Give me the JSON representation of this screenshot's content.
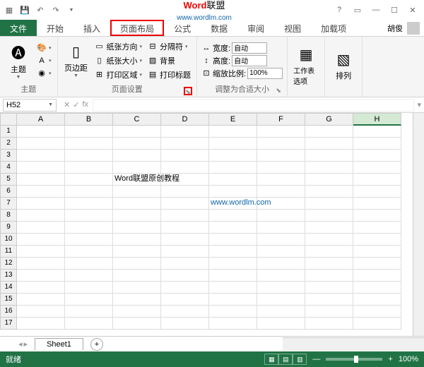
{
  "title": {
    "part1": "Word",
    "part2": "联盟",
    "url": "www.wordlm.com"
  },
  "tabs": {
    "file": "文件",
    "home": "开始",
    "insert": "插入",
    "pagelayout": "页面布局",
    "formulas": "公式",
    "data": "数据",
    "review": "审阅",
    "view": "视图",
    "addins": "加载项"
  },
  "user": "胡俊",
  "ribbon": {
    "themes": {
      "label": "主题",
      "btn": "主题"
    },
    "pagesetup": {
      "label": "页面设置",
      "margins": "页边距",
      "orientation": "纸张方向",
      "size": "纸张大小",
      "printarea": "打印区域",
      "breaks": "分隔符",
      "background": "背景",
      "titles": "打印标题"
    },
    "scale": {
      "label": "调整为合适大小",
      "width_lbl": "宽度:",
      "height_lbl": "高度:",
      "scale_lbl": "缩放比例:",
      "width_val": "自动",
      "height_val": "自动",
      "scale_val": "100%"
    },
    "sheetopts": {
      "label": "工作表选项"
    },
    "arrange": {
      "label": "排列"
    }
  },
  "namebox": "H52",
  "columns": [
    "A",
    "B",
    "C",
    "D",
    "E",
    "F",
    "G",
    "H"
  ],
  "row_count": 17,
  "cells": {
    "C5": "Word联盟原创教程",
    "E7": "www.wordlm.com"
  },
  "sheet": {
    "name": "Sheet1"
  },
  "status": {
    "ready": "就绪",
    "zoom": "100%"
  }
}
